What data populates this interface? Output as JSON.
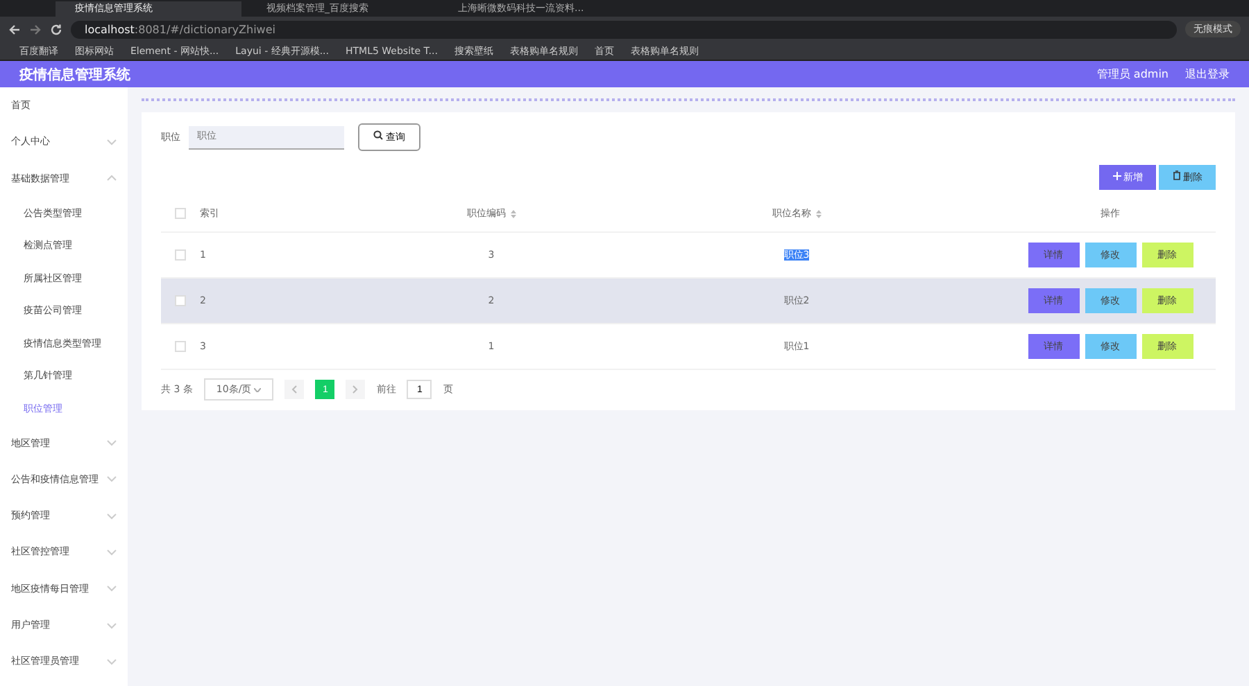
{
  "browser": {
    "tabs": [
      {
        "title": "疫情信息管理系统",
        "selected": true
      },
      {
        "title": "视频档案管理_百度搜索",
        "selected": false
      },
      {
        "title": "上海晰微数码科技一流资料...",
        "selected": false
      }
    ],
    "url": {
      "host": "localhost",
      "rest": ":8081/#/dictionaryZhiwei"
    },
    "profile": "无痕模式",
    "bookmarks": [
      "百度翻译",
      "图标网站",
      "Element - 网站快...",
      "Layui - 经典开源模...",
      "HTML5 Website T...",
      "搜索壁纸",
      "表格购单名规则",
      "首页",
      "表格购单名规则"
    ]
  },
  "header": {
    "title": "疫情信息管理系统",
    "user": "管理员 admin",
    "logout": "退出登录"
  },
  "sidebar": {
    "items": [
      {
        "label": "首页",
        "expandable": false,
        "selected": false
      },
      {
        "label": "个人中心",
        "expandable": true,
        "expanded": false,
        "selected": false
      },
      {
        "label": "基础数据管理",
        "expandable": true,
        "expanded": true,
        "selected": false,
        "children": [
          {
            "label": "公告类型管理",
            "selected": false
          },
          {
            "label": "检测点管理",
            "selected": false
          },
          {
            "label": "所属社区管理",
            "selected": false
          },
          {
            "label": "疫苗公司管理",
            "selected": false
          },
          {
            "label": "疫情信息类型管理",
            "selected": false
          },
          {
            "label": "第几针管理",
            "selected": false
          },
          {
            "label": "职位管理",
            "selected": true
          }
        ]
      },
      {
        "label": "地区管理",
        "expandable": true,
        "expanded": false,
        "selected": false
      },
      {
        "label": "公告和疫情信息管理",
        "expandable": true,
        "expanded": false,
        "selected": false
      },
      {
        "label": "预约管理",
        "expandable": true,
        "expanded": false,
        "selected": false
      },
      {
        "label": "社区管控管理",
        "expandable": true,
        "expanded": false,
        "selected": false
      },
      {
        "label": "地区疫情每日管理",
        "expandable": true,
        "expanded": false,
        "selected": false
      },
      {
        "label": "用户管理",
        "expandable": true,
        "expanded": false,
        "selected": false
      },
      {
        "label": "社区管理员管理",
        "expandable": true,
        "expanded": false,
        "selected": false
      }
    ]
  },
  "search": {
    "label": "职位",
    "placeholder": "职位",
    "button": "查询"
  },
  "toolbar": {
    "add": "新增",
    "delete": "删除"
  },
  "table": {
    "all_checked": false,
    "columns": [
      {
        "label": "索引",
        "sortable": false
      },
      {
        "label": "职位编码",
        "sortable": true
      },
      {
        "label": "职位名称",
        "sortable": true
      },
      {
        "label": "操作",
        "sortable": false
      }
    ],
    "rows": [
      {
        "index": "1",
        "code": "3",
        "name": "职位3",
        "checked": false,
        "hovered": false,
        "text_selected": true,
        "actions": [
          "详情",
          "修改",
          "删除"
        ]
      },
      {
        "index": "2",
        "code": "2",
        "name": "职位2",
        "checked": false,
        "hovered": true,
        "text_selected": false,
        "actions": [
          "详情",
          "修改",
          "删除"
        ]
      },
      {
        "index": "3",
        "code": "1",
        "name": "职位1",
        "checked": false,
        "hovered": false,
        "text_selected": false,
        "actions": [
          "详情",
          "修改",
          "删除"
        ]
      }
    ]
  },
  "pagination": {
    "total": "共 3 条",
    "page_size": "10条/页",
    "pages": [
      {
        "label": "1",
        "selected": true
      }
    ],
    "goto_label": "前往",
    "goto_value": "1",
    "goto_suffix": "页"
  }
}
